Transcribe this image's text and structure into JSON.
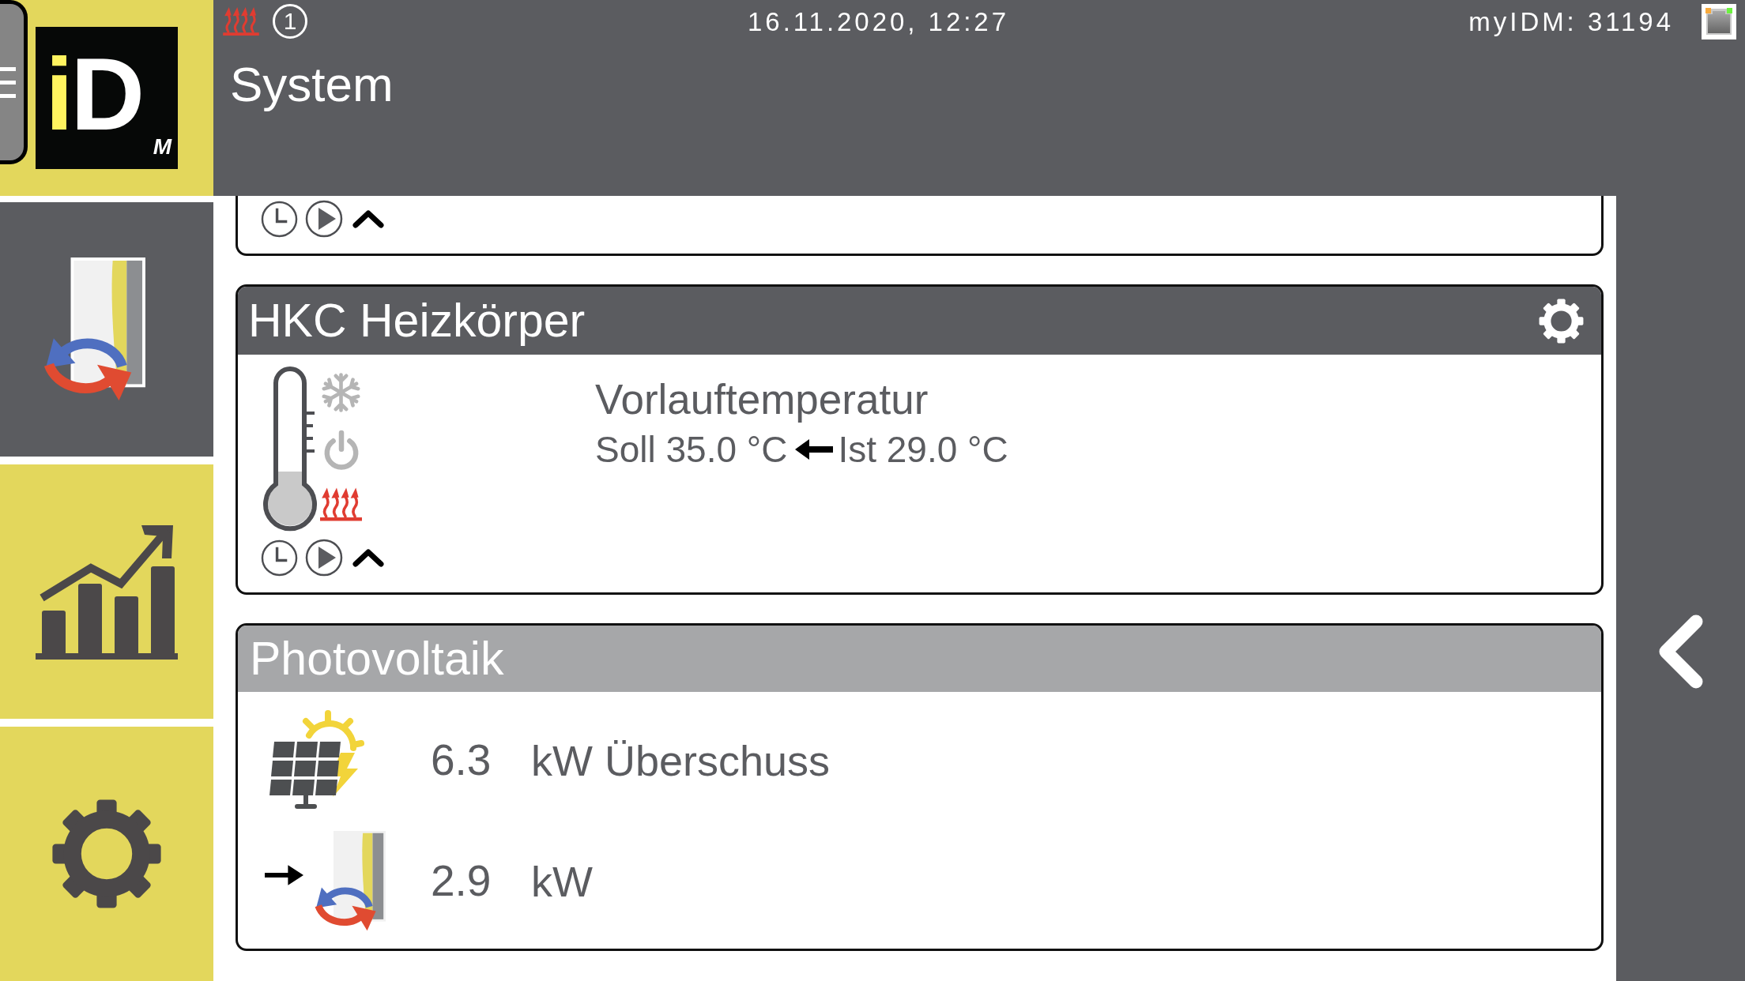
{
  "sidebar": {
    "logo": {
      "text": "iD",
      "mark": "M"
    },
    "items": [
      {
        "kind": "heatpump",
        "selected": true
      },
      {
        "kind": "statistics",
        "selected": false
      },
      {
        "kind": "settings",
        "selected": false
      }
    ]
  },
  "header": {
    "status_count": "1",
    "datetime": "16.11.2020, 12:27",
    "device": "myIDM: 31194",
    "title": "System"
  },
  "cards": [
    {
      "kind": "partial"
    },
    {
      "kind": "circuit",
      "title": "HKC Heizkörper",
      "modes": [
        {
          "kind": "cooling",
          "active": false
        },
        {
          "kind": "standby",
          "active": false
        },
        {
          "kind": "heating",
          "active": true
        }
      ],
      "reading": {
        "label": "Vorlauftemperatur",
        "setpoint": "Soll 35.0 °C",
        "actual": "Ist 29.0 °C"
      }
    },
    {
      "kind": "photovoltaic",
      "title": "Photovoltaik",
      "rows": [
        {
          "kind": "surplus",
          "value": "6.3",
          "unit": "kW Überschuss"
        },
        {
          "kind": "heatpump",
          "value": "2.9",
          "unit": "kW"
        }
      ]
    }
  ]
}
